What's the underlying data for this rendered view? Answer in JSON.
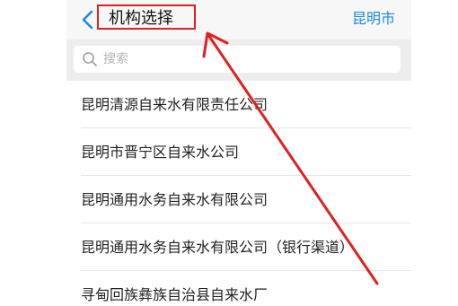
{
  "header": {
    "title": "机构选择",
    "city": "昆明市",
    "back_icon": "chevron-left-icon"
  },
  "search": {
    "placeholder": "搜索",
    "icon": "search-icon"
  },
  "organizations": [
    "昆明清源自来水有限责任公司",
    "昆明市晋宁区自来水公司",
    "昆明通用水务自来水有限公司",
    "昆明通用水务自来水有限公司（银行渠道）",
    "寻甸回族彝族自治县自来水厂"
  ],
  "colors": {
    "accent": "#1e88e5",
    "annotation": "#e02020"
  }
}
